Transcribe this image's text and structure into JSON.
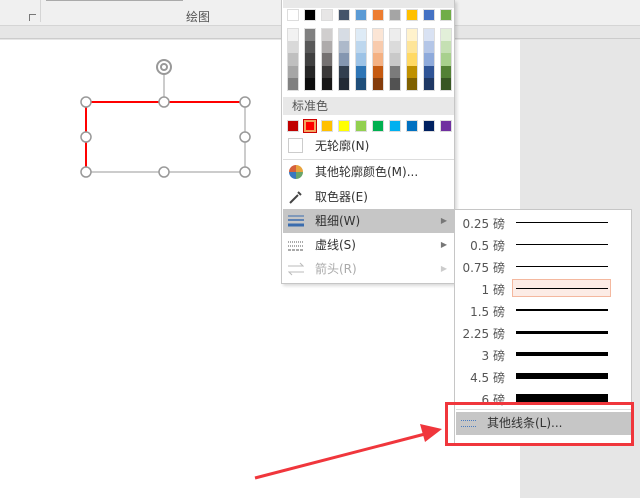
{
  "ribbon": {
    "group_label": "绘图"
  },
  "theme_top_row": [
    "#ffffff",
    "#000000",
    "#e7e6e6",
    "#44546a",
    "#5b9bd5",
    "#ed7d31",
    "#a5a5a5",
    "#ffc000",
    "#4472c4",
    "#70ad47"
  ],
  "theme_shades": [
    [
      "#f2f2f2",
      "#d9d9d9",
      "#bfbfbf",
      "#a6a6a6",
      "#808080"
    ],
    [
      "#808080",
      "#595959",
      "#404040",
      "#262626",
      "#0d0d0d"
    ],
    [
      "#d0cece",
      "#aeabab",
      "#757171",
      "#3a3838",
      "#171616"
    ],
    [
      "#d6dce4",
      "#adb9ca",
      "#8496b0",
      "#323f4f",
      "#222a35"
    ],
    [
      "#deebf6",
      "#bdd7ee",
      "#9dc3e6",
      "#2e75b5",
      "#1f4e79"
    ],
    [
      "#fbe5d5",
      "#f8cbad",
      "#f4b183",
      "#c55a11",
      "#843c0b"
    ],
    [
      "#ededed",
      "#dbdbdb",
      "#c9c9c9",
      "#7b7b7b",
      "#525252"
    ],
    [
      "#fff2cc",
      "#fee599",
      "#ffd965",
      "#bf9000",
      "#7f6000"
    ],
    [
      "#d9e2f3",
      "#b4c6e7",
      "#8eaadb",
      "#2f5496",
      "#1f3864"
    ],
    [
      "#e2efd9",
      "#c5e0b3",
      "#a8d08d",
      "#538135",
      "#375623"
    ]
  ],
  "standard_header": "标准色",
  "standard_colors": [
    "#c00000",
    "#ff0000",
    "#ffc000",
    "#ffff00",
    "#92d050",
    "#00b050",
    "#00b0f0",
    "#0070c0",
    "#002060",
    "#7030a0"
  ],
  "menu": {
    "no_outline": "无轮廓(N)",
    "more_colors": "其他轮廓颜色(M)...",
    "eyedropper": "取色器(E)",
    "weight": "粗细(W)",
    "dashes": "虚线(S)",
    "arrows": "箭头(R)"
  },
  "weights": [
    {
      "label": "0.25 磅",
      "pt": 0.25
    },
    {
      "label": "0.5 磅",
      "pt": 0.5
    },
    {
      "label": "0.75 磅",
      "pt": 0.75
    },
    {
      "label": "1 磅",
      "pt": 1,
      "selected": true
    },
    {
      "label": "1.5 磅",
      "pt": 1.5
    },
    {
      "label": "2.25 磅",
      "pt": 2.25
    },
    {
      "label": "3 磅",
      "pt": 3
    },
    {
      "label": "4.5 磅",
      "pt": 4.5
    },
    {
      "label": "6 磅",
      "pt": 6
    }
  ],
  "more_lines": "其他线条(L)...",
  "annotation_color": "#f0363c"
}
